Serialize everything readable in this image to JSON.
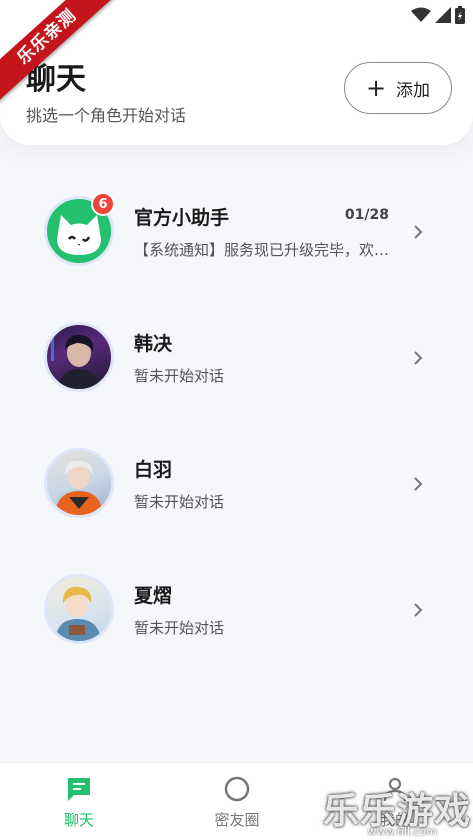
{
  "header": {
    "title": "聊天",
    "subtitle": "挑选一个角色开始对话",
    "add_button": {
      "icon": "plus-icon",
      "label": "添加"
    }
  },
  "ribbon": {
    "text": "乐乐亲测"
  },
  "chats": [
    {
      "name": "官方小助手",
      "preview": "【系统通知】服务现已升级完毕，欢迎使用",
      "time": "01/28",
      "badge": "6",
      "avatar": "cat-avatar"
    },
    {
      "name": "韩决",
      "preview": "暂未开始对话",
      "avatar": "character-avatar"
    },
    {
      "name": "白羽",
      "preview": "暂未开始对话",
      "avatar": "character-avatar"
    },
    {
      "name": "夏熠",
      "preview": "暂未开始对话",
      "avatar": "character-avatar"
    }
  ],
  "nav": [
    {
      "label": "聊天",
      "icon": "chat-bubble-icon",
      "active": true
    },
    {
      "label": "密友圈",
      "icon": "circle-icon",
      "active": false
    },
    {
      "label": "我的",
      "icon": "person-icon",
      "active": false
    }
  ],
  "colors": {
    "accent": "#22c06f",
    "badge": "#f0433c",
    "ribbon": "#c4141c"
  },
  "watermark": {
    "text": "乐乐游戏",
    "url": "www.6ll.com"
  }
}
